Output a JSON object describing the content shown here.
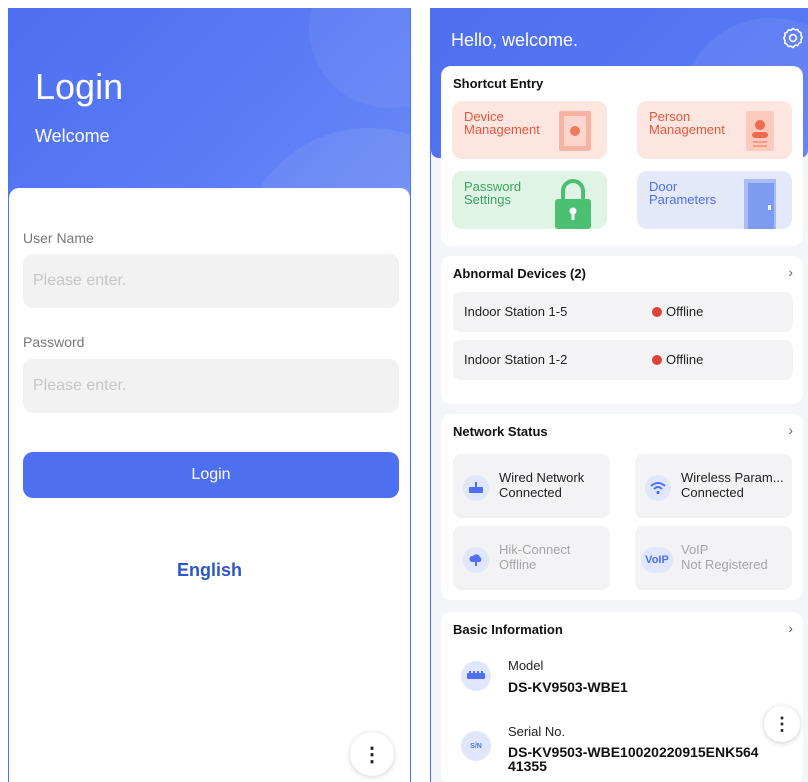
{
  "login": {
    "title": "Login",
    "subtitle": "Welcome",
    "username_label": "User Name",
    "username_placeholder": "Please enter.",
    "password_label": "Password",
    "password_placeholder": "Please enter.",
    "login_button": "Login",
    "language": "English",
    "more_icon": "⋮"
  },
  "home": {
    "greeting": "Hello, welcome.",
    "shortcut": {
      "title": "Shortcut Entry",
      "tiles": [
        {
          "line1": "Device",
          "line2": "Management",
          "icon": "device-book-icon",
          "color": "#e8573c"
        },
        {
          "line1": "Person",
          "line2": "Management",
          "icon": "person-badge-icon",
          "color": "#e8573c"
        },
        {
          "line1": "Password",
          "line2": "Settings",
          "icon": "lock-icon",
          "color": "#3aa55e"
        },
        {
          "line1": "Door",
          "line2": "Parameters",
          "icon": "door-icon",
          "color": "#4d6ff0"
        }
      ]
    },
    "abnormal": {
      "title": "Abnormal Devices (2)",
      "chevron": "›",
      "devices": [
        {
          "name": "Indoor Station  1-5",
          "status": "Offline"
        },
        {
          "name": "Indoor Station  1-2",
          "status": "Offline"
        }
      ]
    },
    "network": {
      "title": "Network Status",
      "chevron": "›",
      "items": [
        {
          "name": "Wired Network",
          "status": "Connected",
          "icon": "router-icon"
        },
        {
          "name": "Wireless Param...",
          "status": "Connected",
          "icon": "wifi-icon"
        },
        {
          "name": "Hik-Connect",
          "status": "Offline",
          "icon": "cloud-icon"
        },
        {
          "name": "VoIP",
          "status": "Not Registered",
          "icon": "voip-icon",
          "badge": "VoIP"
        }
      ]
    },
    "basic": {
      "title": "Basic Information",
      "chevron": "›",
      "model_label": "Model",
      "model_value": "DS-KV9503-WBE1",
      "serial_label": "Serial No.",
      "serial_value_line1": "DS-KV9503-WBE10020220915ENK564",
      "serial_value_line2": "41355",
      "serial_icon_text": "S/N"
    },
    "more_icon": "⋮"
  },
  "colors": {
    "primary": "#4d6ff0",
    "link": "#2e56c9",
    "offline_dot": "#e0413c"
  }
}
